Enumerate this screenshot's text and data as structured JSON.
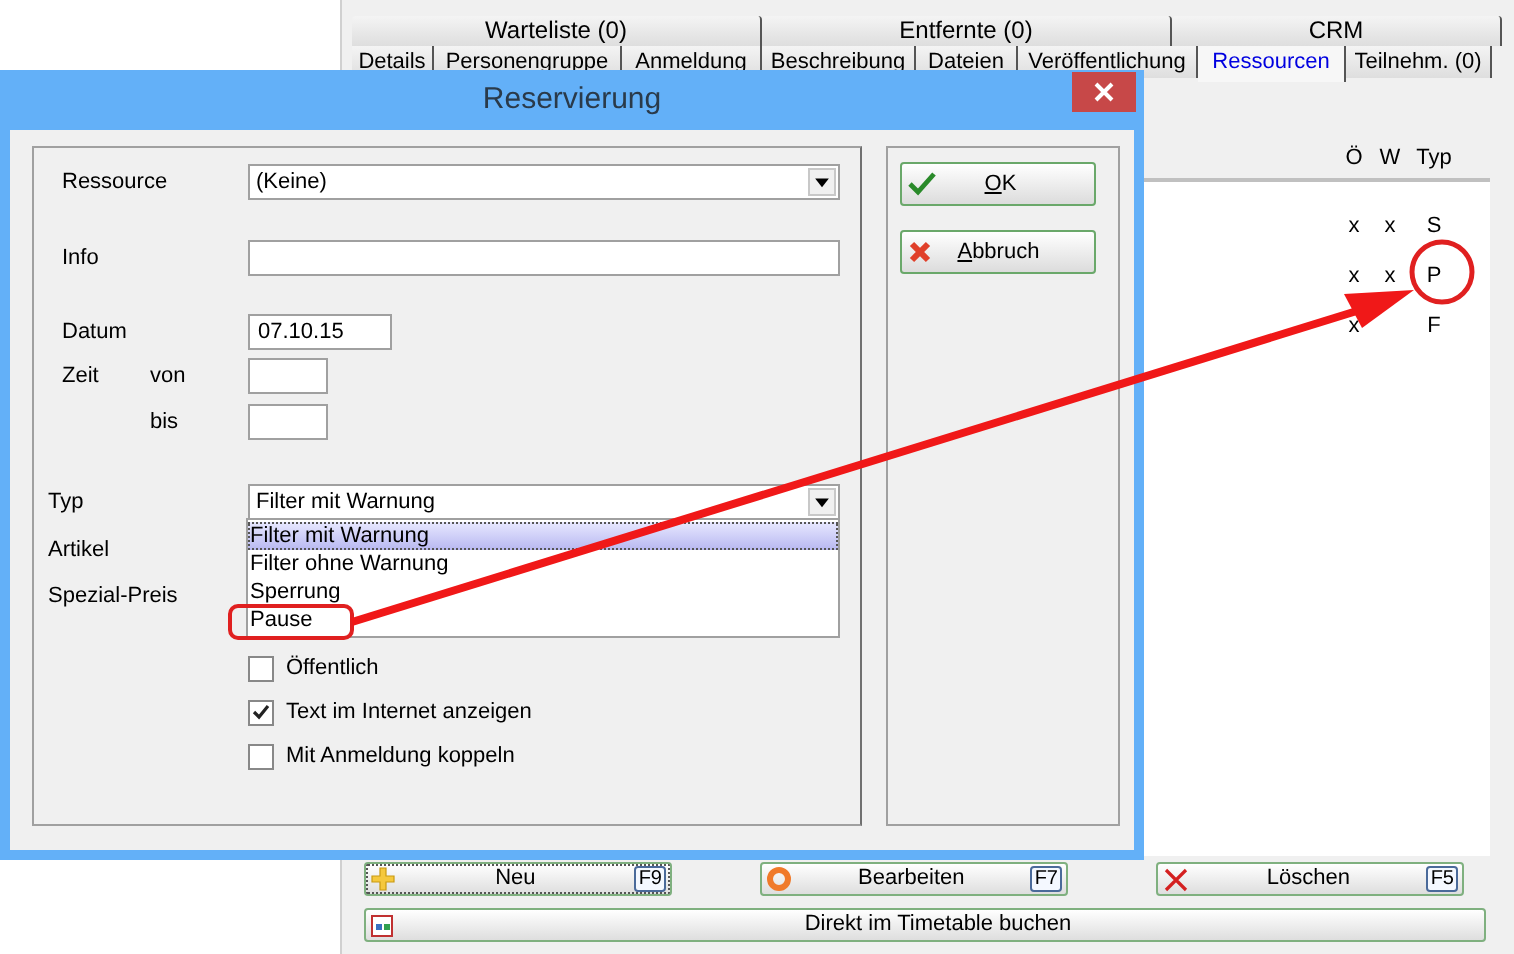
{
  "background_window": {
    "tab_rows": [
      [
        {
          "label": "Warteliste (0)",
          "selected": false
        },
        {
          "label": "Entfernte (0)",
          "selected": false
        },
        {
          "label": "CRM",
          "selected": false
        }
      ],
      [
        {
          "label": "Details",
          "selected": false
        },
        {
          "label": "Personengruppe",
          "selected": false
        },
        {
          "label": "Anmeldung",
          "selected": false
        },
        {
          "label": "Beschreibung",
          "selected": false
        },
        {
          "label": "Dateien",
          "selected": false
        },
        {
          "label": "Veröffentlichung",
          "selected": false
        },
        {
          "label": "Ressourcen",
          "selected": true
        },
        {
          "label": "Teilnehm. (0)",
          "selected": false
        }
      ]
    ],
    "table": {
      "columns": [
        "Ö",
        "W",
        "Typ"
      ],
      "rows": [
        [
          "x",
          "x",
          "S"
        ],
        [
          "x",
          "x",
          "P"
        ],
        [
          "x",
          "",
          "F"
        ]
      ]
    },
    "buttons": [
      {
        "kind": "add",
        "label": "Neu",
        "shortcut": "F9"
      },
      {
        "kind": "edit",
        "label": "Bearbeiten",
        "shortcut": "F7"
      },
      {
        "kind": "delete",
        "label": "Löschen",
        "shortcut": "F5"
      }
    ],
    "wide_button": {
      "label": "Direkt im Timetable buchen"
    }
  },
  "dialog": {
    "title": "Reservierung",
    "ressource": {
      "label": "Ressource",
      "value": "(Keine)"
    },
    "info": {
      "label": "Info"
    },
    "datum": {
      "label": "Datum",
      "value": "07.10.15"
    },
    "zeit": {
      "label": "Zeit",
      "from_label": "von",
      "to_label": "bis"
    },
    "typ": {
      "label": "Typ",
      "value": "Filter mit Warnung",
      "expanded": true,
      "options": [
        {
          "label": "Filter mit Warnung",
          "selected": true
        },
        {
          "label": "Filter ohne Warnung",
          "selected": false
        },
        {
          "label": "Sperrung",
          "selected": false
        },
        {
          "label": "Pause",
          "selected": false
        }
      ]
    },
    "artikel_label": "Artikel",
    "spezial_preis_label": "Spezial-Preis",
    "checkboxes": [
      {
        "label": "Öffentlich",
        "checked": false
      },
      {
        "label": "Text im Internet anzeigen",
        "checked": true
      },
      {
        "label": "Mit Anmeldung koppeln",
        "checked": false
      }
    ],
    "buttons": [
      {
        "kind": "ok",
        "label": "OK"
      },
      {
        "kind": "cancel",
        "label": "Abbruch"
      }
    ]
  }
}
